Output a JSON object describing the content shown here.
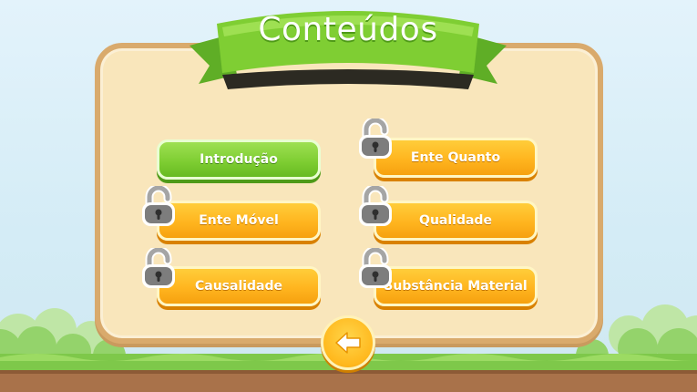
{
  "header": {
    "title": "Conteúdos"
  },
  "menu": {
    "items": [
      {
        "label": "Introdução",
        "locked": false,
        "state": "unlocked"
      },
      {
        "label": "Ente Quanto",
        "locked": true,
        "state": "locked"
      },
      {
        "label": "Ente Móvel",
        "locked": true,
        "state": "locked"
      },
      {
        "label": "Qualidade",
        "locked": true,
        "state": "locked"
      },
      {
        "label": "Causalidade",
        "locked": true,
        "state": "locked"
      },
      {
        "label": "Substância Material",
        "locked": true,
        "state": "locked"
      }
    ]
  },
  "controls": {
    "back_icon": "back-arrow-icon",
    "lock_icon": "padlock-icon"
  },
  "colors": {
    "banner_green": "#7fce33",
    "button_orange": "#ffb51f",
    "button_green": "#7fce33",
    "panel_cream": "#f9e6bb",
    "panel_border": "#d9aa6c",
    "lock_gray": "#8c8c8c"
  }
}
